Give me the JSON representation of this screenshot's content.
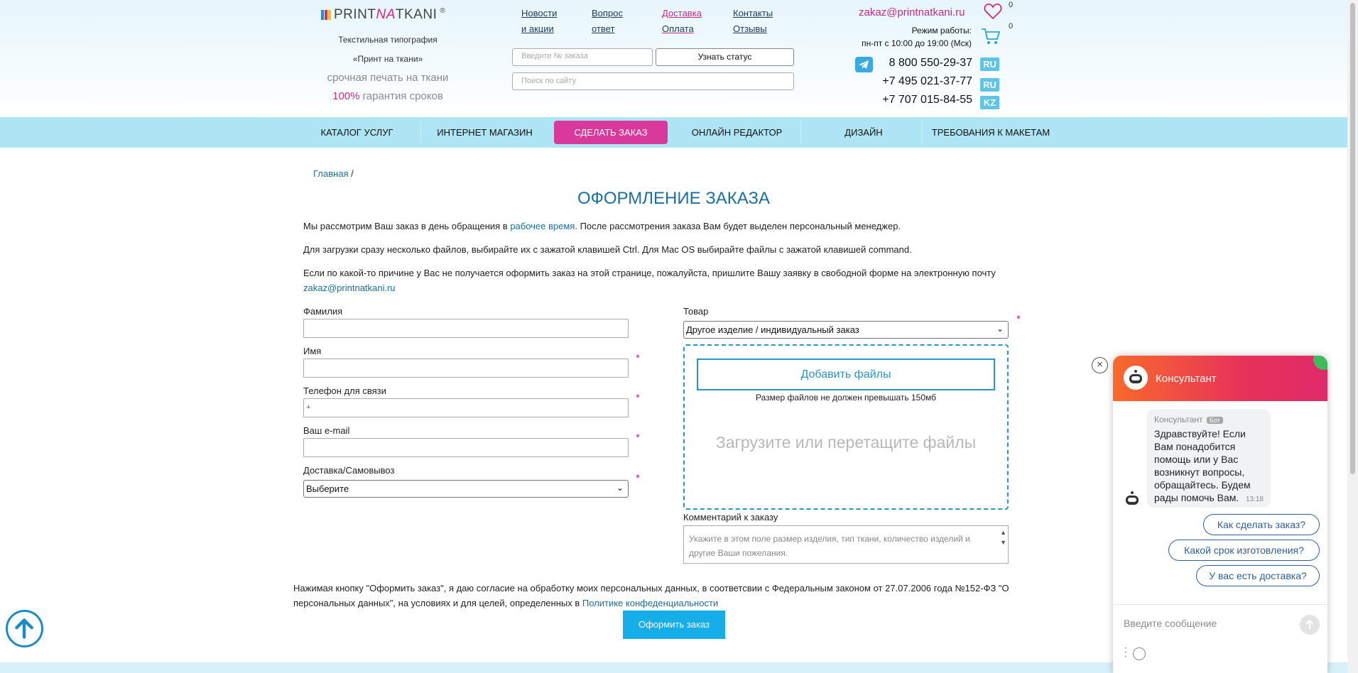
{
  "header": {
    "logo_prefix": "PRINT",
    "logo_na": "NA",
    "logo_suffix": "TKANI",
    "logo_reg": "®",
    "tagline1": "Текстильная типография",
    "tagline2": "«Принт на ткани»",
    "tagline3": "срочная печать на ткани",
    "tagline4_pct": "100%",
    "tagline4_rest": " гарантия сроков",
    "nav": [
      {
        "l1": "Новости",
        "l2": "и акции"
      },
      {
        "l1": "Вопрос",
        "l2": "ответ"
      },
      {
        "l1": "Доставка",
        "l2": "Оплата"
      },
      {
        "l1": "Контакты",
        "l2": "Отзывы"
      }
    ],
    "order_placeholder": "Введите № заказа",
    "status_button": "Узнать статус",
    "search_placeholder": "Поиск по сайту",
    "email": "zakaz@printnatkani.ru",
    "wishlist_count": "0",
    "cart_count": "0",
    "work_l1": "Режим работы:",
    "work_l2": "пн-пт с 10:00 до 19:00 (Мск)",
    "phones": [
      "8 800 550-29-37",
      "+7 495 021-37-77",
      "+7 707 015-84-55"
    ],
    "flags": [
      "RU",
      "RU",
      "KZ"
    ],
    "accent_color": "#d6287f",
    "link_color": "#1a6fa0"
  },
  "mainnav": {
    "items": [
      "КАТАЛОГ УСЛУГ",
      "ИНТЕРНЕТ МАГАЗИН",
      "СДЕЛАТЬ ЗАКАЗ",
      "ОНЛАЙН РЕДАКТОР",
      "ДИЗАЙН",
      "ТРЕБОВАНИЯ К МАКЕТАМ"
    ]
  },
  "breadcrumb": {
    "home": "Главная",
    "sep": " /"
  },
  "page": {
    "title": "ОФОРМЛЕНИЕ ЗАКАЗА",
    "p1_a": "Мы рассмотрим Ваш заказ в день обращения в ",
    "p1_link": "рабочее время",
    "p1_b": ". После рассмотрения заказа Вам будет выделен персональный менеджер.",
    "p2": "Для загрузки сразу несколько файлов, выбирайте их с зажатой клавишей Ctrl. Для Mac OS выбирайте файлы с зажатой клавишей command.",
    "p3": "Если по какой-то причине у Вас не получается оформить заказ на этой странице, пожалуйста, пришлите Вашу заявку в свободной форме на электронную почту",
    "p3_email": "zakaz@printnatkani.ru"
  },
  "form": {
    "surname_label": "Фамилия",
    "name_label": "Имя",
    "phone_label": "Телефон для связи",
    "phone_value": "+",
    "email_label": "Ваш e-mail",
    "delivery_label": "Доставка/Самовывоз",
    "delivery_value": "Выберите",
    "product_label": "Товар",
    "product_value": "Другое изделие / индивидуальный заказ",
    "add_files": "Добавить файлы",
    "size_note": "Размер файлов не должен превышать 150мб",
    "drop_text": "Загрузите или перетащите файлы",
    "comment_label": "Комментарий к заказу",
    "comment_placeholder": "Укажите в этом поле размер изделия, тип ткани, количество изделий и другие Ваши пожелания.",
    "required": "*",
    "consent_a": "Нажимая кнопку \"Оформить заказ\", я даю согласие на обработку моих персональных данных, в соответсвии с Федеральным законом от 27.07.2006 года №152-ФЗ \"О персональных данных\", на условиях и для целей, определенных в ",
    "consent_link": "Политике конфеденциальности",
    "submit": "Оформить заказ"
  },
  "chat": {
    "title": "Консультант",
    "sender": "Консультант",
    "badge": "Бот",
    "message": "Здравствуйте! Если Вам понадобится помощь или у Вас возникнут вопросы, обращайтесь. Будем рады помочь Вам.",
    "time": "13:18",
    "quick": [
      "Как сделать заказ?",
      "Какой срок изготовления?",
      "У вас есть доставка?"
    ],
    "input_placeholder": "Введите сообщение",
    "close": "×"
  }
}
